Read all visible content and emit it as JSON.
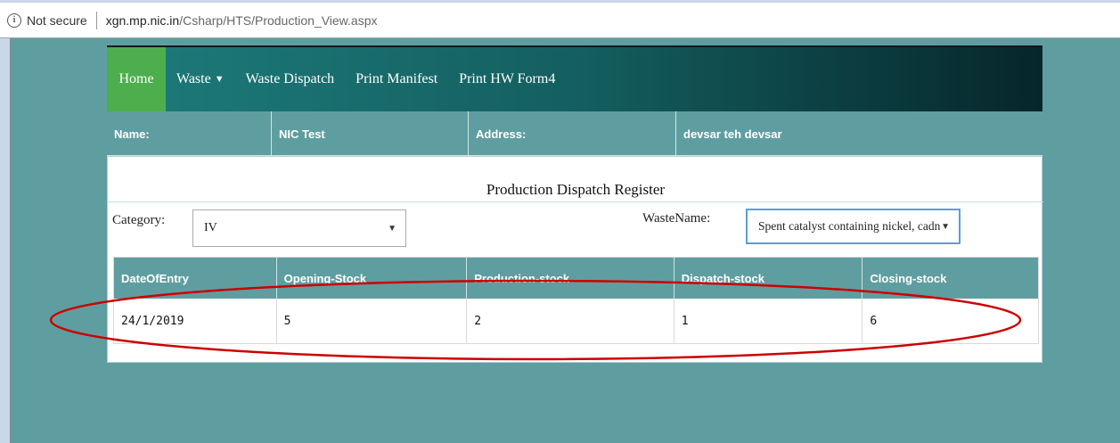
{
  "browser": {
    "security_text": "Not secure",
    "url_host": "xgn.mp.nic.in",
    "url_path": "/Csharp/HTS/Production_View.aspx"
  },
  "nav": {
    "home": "Home",
    "waste": "Waste",
    "waste_dispatch": "Waste Dispatch",
    "print_manifest": "Print Manifest",
    "print_hw_form4": "Print HW Form4"
  },
  "info": {
    "name_label": "Name:",
    "name_value": "NIC Test",
    "address_label": "Address:",
    "address_value": "devsar teh devsar"
  },
  "page": {
    "title": "Production Dispatch Register"
  },
  "filters": {
    "category_label": "Category:",
    "category_value": "IV",
    "wastename_label": "WasteName:",
    "wastename_value": "Spent catalyst containing nickel, cadn"
  },
  "grid": {
    "headers": [
      "DateOfEntry",
      "Opening-Stock",
      "Production-stock",
      "Dispatch-stock",
      "Closing-stock"
    ],
    "rows": [
      [
        "24/1/2019",
        "5",
        "2",
        "1",
        "6"
      ]
    ]
  },
  "colors": {
    "accent_teal": "#5f9ea0",
    "home_green": "#4cae4c",
    "annotation_red": "#cc0000"
  }
}
